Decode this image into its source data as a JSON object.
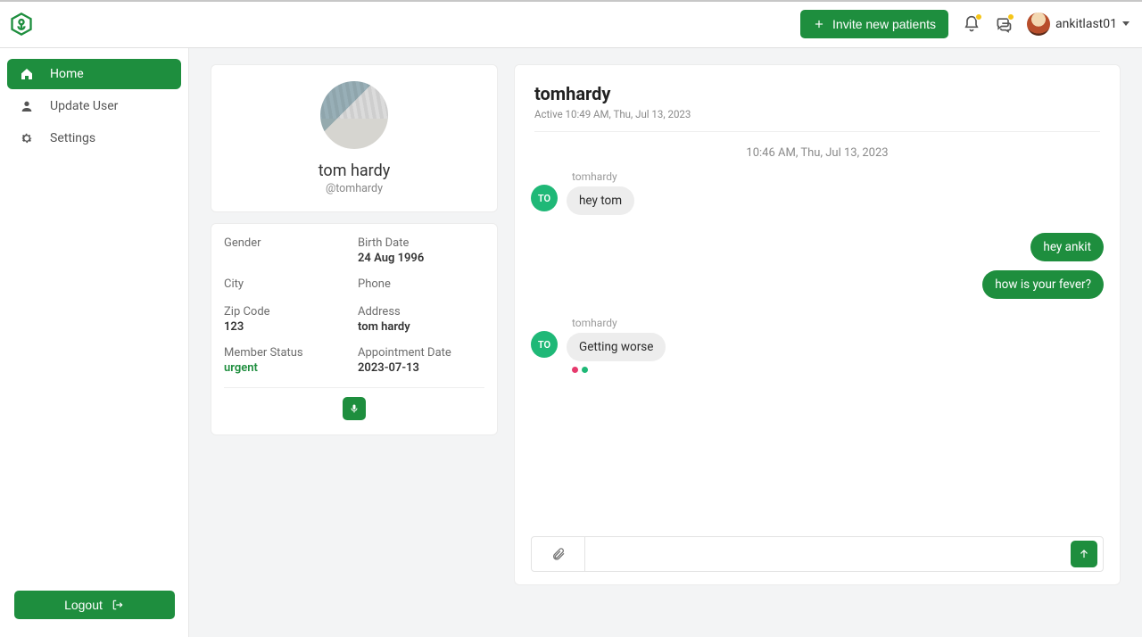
{
  "header": {
    "invite_label": "Invite new patients",
    "username": "ankitlast01"
  },
  "sidebar": {
    "items": [
      {
        "label": "Home"
      },
      {
        "label": "Update User"
      },
      {
        "label": "Settings"
      }
    ],
    "logout_label": "Logout"
  },
  "profile": {
    "display_name": "tom hardy",
    "handle": "@tomhardy",
    "fields": {
      "gender_label": "Gender",
      "gender_value": "",
      "birth_label": "Birth Date",
      "birth_value": "24 Aug 1996",
      "city_label": "City",
      "city_value": "",
      "phone_label": "Phone",
      "phone_value": "",
      "zip_label": "Zip Code",
      "zip_value": "123",
      "address_label": "Address",
      "address_value": "tom hardy",
      "status_label": "Member Status",
      "status_value": "urgent",
      "appt_label": "Appointment Date",
      "appt_value": "2023-07-13"
    }
  },
  "chat": {
    "title": "tomhardy",
    "active_text": "Active 10:49 AM, Thu, Jul 13, 2023",
    "date_divider": "10:46 AM, Thu, Jul 13, 2023",
    "avatar_initials": "TO",
    "messages": {
      "g1_sender": "tomhardy",
      "g1_m1": "hey tom",
      "mine_m1": "hey ankit",
      "mine_m2": "how is your fever?",
      "g2_sender": "tomhardy",
      "g2_m1": "Getting worse"
    },
    "input_placeholder": ""
  }
}
